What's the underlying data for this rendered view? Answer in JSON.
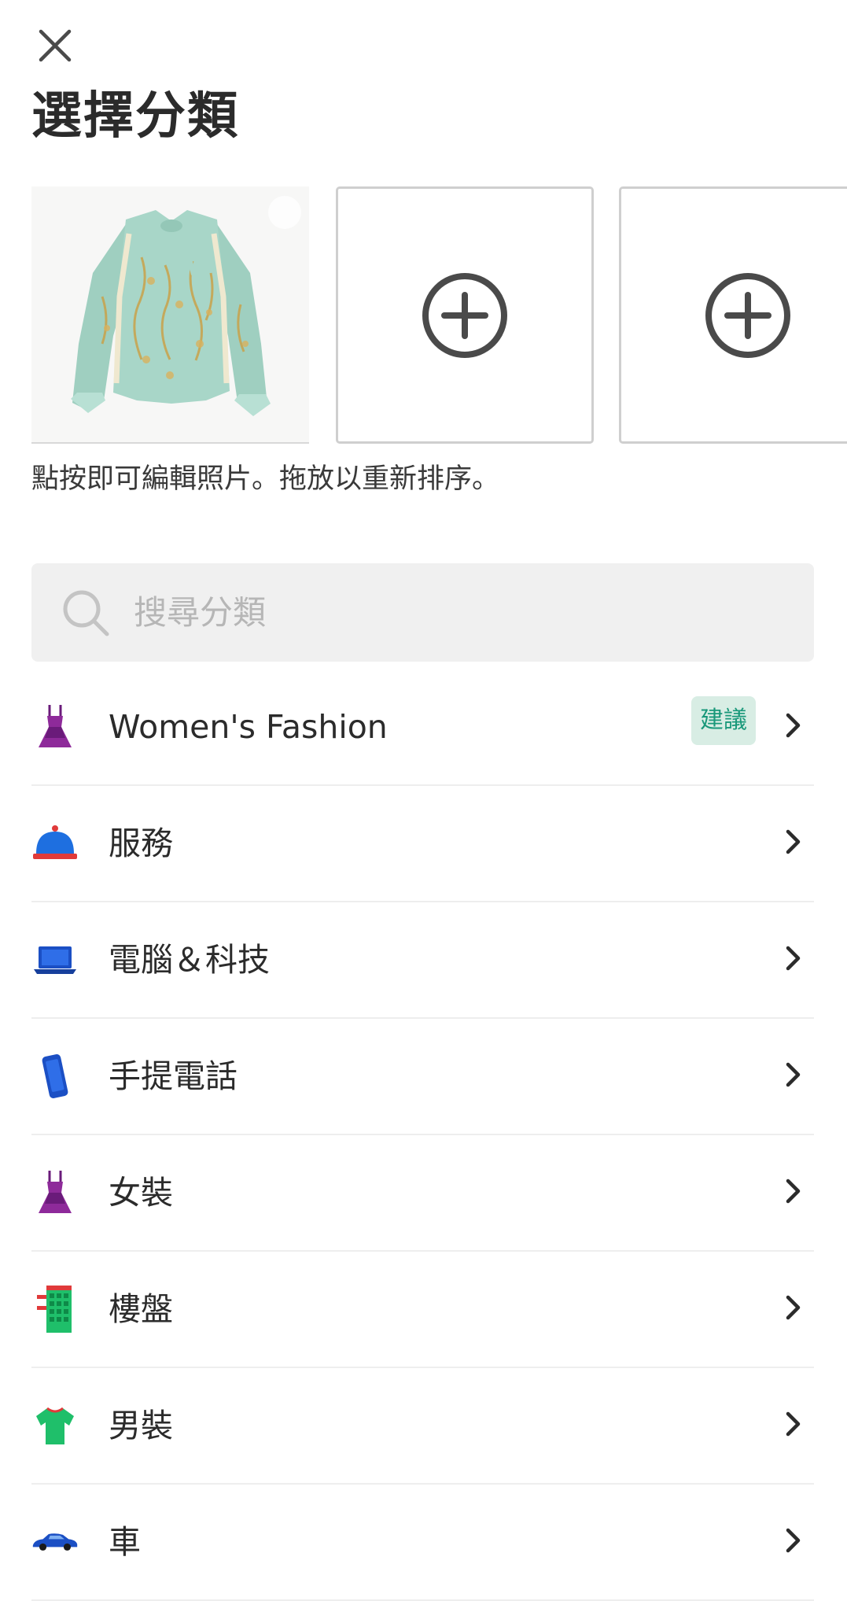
{
  "header": {
    "title": "選擇分類"
  },
  "photos": {
    "hint": "點按即可編輯照片。拖放以重新排序。"
  },
  "search": {
    "placeholder": "搜尋分類"
  },
  "categories": [
    {
      "label": "Women's Fashion",
      "icon": "dress-icon",
      "badge": "建議"
    },
    {
      "label": "服務",
      "icon": "service-bell-icon"
    },
    {
      "label": "電腦＆科技",
      "icon": "laptop-icon"
    },
    {
      "label": "手提電話",
      "icon": "mobile-phone-icon"
    },
    {
      "label": "女裝",
      "icon": "dress-icon"
    },
    {
      "label": "樓盤",
      "icon": "building-icon"
    },
    {
      "label": "男裝",
      "icon": "t-shirt-icon"
    },
    {
      "label": "車",
      "icon": "car-icon"
    }
  ],
  "colors": {
    "badge_bg": "#d8ede4",
    "badge_text": "#19987a",
    "search_bg": "#f0f0f0"
  }
}
